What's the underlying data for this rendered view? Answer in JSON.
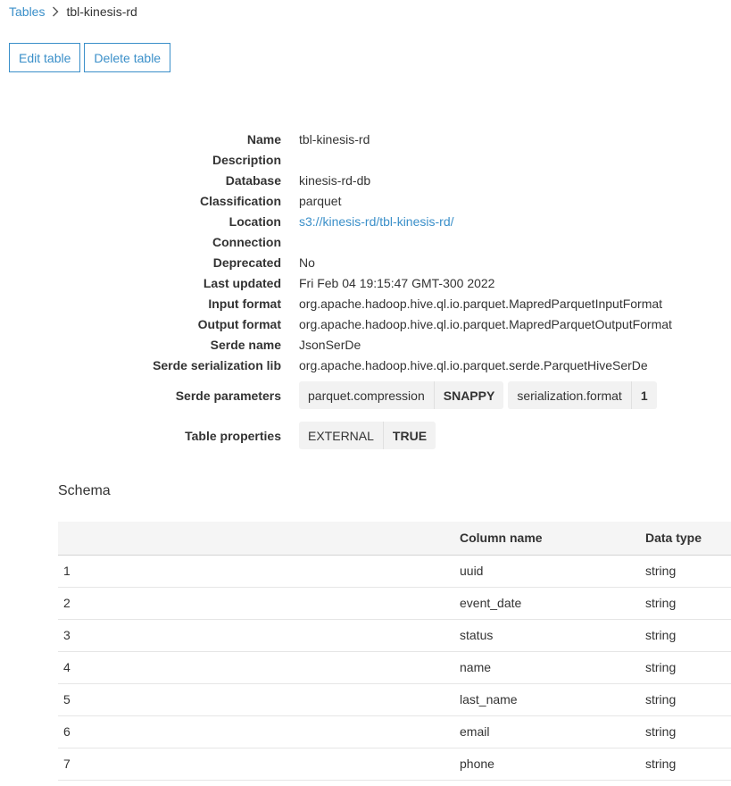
{
  "breadcrumb": {
    "root": "Tables",
    "current": "tbl-kinesis-rd"
  },
  "actions": {
    "edit_label": "Edit table",
    "delete_label": "Delete table"
  },
  "properties": [
    {
      "label": "Name",
      "value": "tbl-kinesis-rd"
    },
    {
      "label": "Description",
      "value": ""
    },
    {
      "label": "Database",
      "value": "kinesis-rd-db"
    },
    {
      "label": "Classification",
      "value": "parquet"
    },
    {
      "label": "Location",
      "value": "s3://kinesis-rd/tbl-kinesis-rd/"
    },
    {
      "label": "Connection",
      "value": ""
    },
    {
      "label": "Deprecated",
      "value": "No"
    },
    {
      "label": "Last updated",
      "value": "Fri Feb 04 19:15:47 GMT-300 2022"
    },
    {
      "label": "Input format",
      "value": "org.apache.hadoop.hive.ql.io.parquet.MapredParquetInputFormat"
    },
    {
      "label": "Output format",
      "value": "org.apache.hadoop.hive.ql.io.parquet.MapredParquetOutputFormat"
    },
    {
      "label": "Serde name",
      "value": "JsonSerDe"
    },
    {
      "label": "Serde serialization lib",
      "value": "org.apache.hadoop.hive.ql.io.parquet.serde.ParquetHiveSerDe"
    }
  ],
  "serde_parameters": {
    "label": "Serde parameters",
    "items": [
      {
        "key": "parquet.compression",
        "value": "SNAPPY"
      },
      {
        "key": "serialization.format",
        "value": "1"
      }
    ]
  },
  "table_properties": {
    "label": "Table properties",
    "items": [
      {
        "key": "EXTERNAL",
        "value": "TRUE"
      }
    ]
  },
  "schema": {
    "title": "Schema",
    "headers": {
      "index": "",
      "column_name": "Column name",
      "data_type": "Data type"
    },
    "rows": [
      {
        "index": "1",
        "column_name": "uuid",
        "data_type": "string"
      },
      {
        "index": "2",
        "column_name": "event_date",
        "data_type": "string"
      },
      {
        "index": "3",
        "column_name": "status",
        "data_type": "string"
      },
      {
        "index": "4",
        "column_name": "name",
        "data_type": "string"
      },
      {
        "index": "5",
        "column_name": "last_name",
        "data_type": "string"
      },
      {
        "index": "6",
        "column_name": "email",
        "data_type": "string"
      },
      {
        "index": "7",
        "column_name": "phone",
        "data_type": "string"
      }
    ]
  },
  "colors": {
    "link": "#3a8fc9",
    "text": "#333333",
    "tag_bg": "#f2f2f2",
    "header_bg": "#f5f5f5"
  }
}
